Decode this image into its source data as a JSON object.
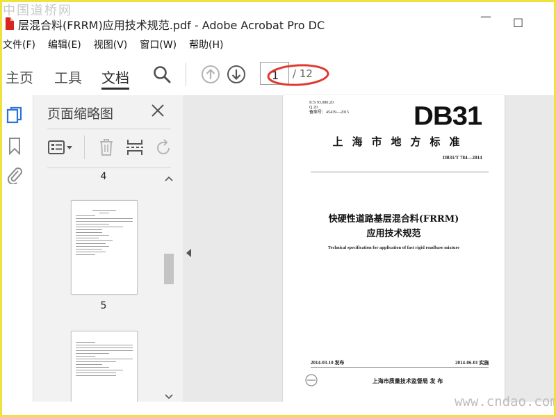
{
  "watermarks": {
    "top": "中国道桥网",
    "bottom": "www.cndao.com"
  },
  "window": {
    "title": "层混合料(FRRM)应用技术规范.pdf - Adobe Acrobat Pro DC",
    "minimize_glyph": "—",
    "restore_glyph": "□"
  },
  "menu": {
    "items": [
      "文件(F)",
      "编辑(E)",
      "视图(V)",
      "窗口(W)",
      "帮助(H)"
    ]
  },
  "toolbar": {
    "tabs": [
      "主页",
      "工具",
      "文档"
    ],
    "active_tab": "文档",
    "icons": [
      "search-icon",
      "arrow-up-circle-icon",
      "arrow-down-circle-icon"
    ],
    "page_current": "1",
    "page_total": "/ 12",
    "annotation_color": "#e03a2e"
  },
  "sidebar": {
    "icons": [
      "page-thumbnails-icon",
      "bookmark-icon",
      "attachment-icon"
    ],
    "active_icon_color": "#2a73d9"
  },
  "thumbnails_panel": {
    "title": "页面缩略图",
    "tool_icons": [
      "thumbnail-options-icon",
      "trash-icon",
      "extract-page-icon",
      "rotate-icon"
    ],
    "pages": [
      {
        "label": "4"
      },
      {
        "label": "5"
      }
    ]
  },
  "document_page": {
    "ics_lines": [
      "ICS 93.080.20",
      "Q 20",
      "备案号：45439—2015"
    ],
    "code": "DB31",
    "authority": "上海市地方标准",
    "number": "DB31/T 784—2014",
    "title_line1": "快硬性道路基层混合料(FRRM)",
    "title_line2": "应用技术规范",
    "title_en": "Technical specification for application of fast rigid roadbase mixture",
    "issue_date": "2014-03-10 发布",
    "implement_date": "2014-06-01 实施",
    "publisher": "上海市质量技术监督局    发 布"
  }
}
